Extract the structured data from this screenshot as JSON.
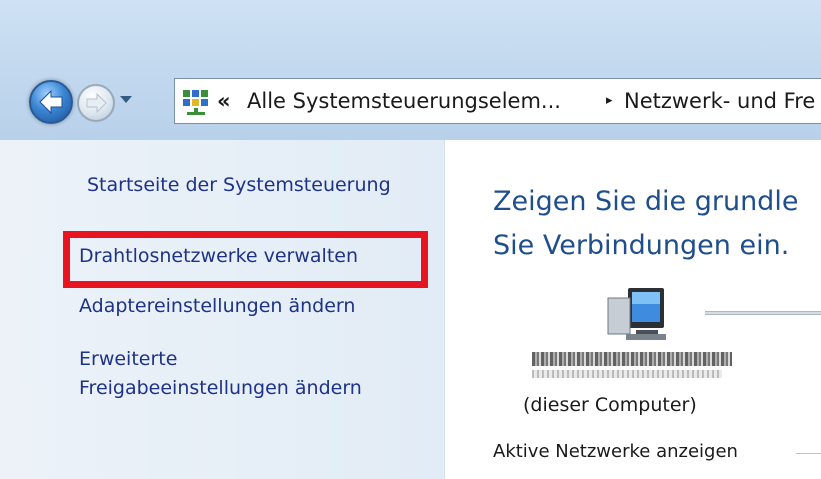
{
  "toolbar": {
    "back_icon": "back-arrow-icon",
    "forward_icon": "forward-arrow-icon",
    "history_icon": "chevron-down-icon"
  },
  "address_bar": {
    "icon": "control-panel-icon",
    "chevrons": "«",
    "crumbs": [
      "Alle Systemsteuerungselem...",
      "Netzwerk- und Fre"
    ],
    "separator": "▸"
  },
  "sidebar": {
    "items": [
      {
        "label": "Startseite der Systemsteuerung"
      },
      {
        "label": "Drahtlosnetzwerke verwalten",
        "highlighted": true
      },
      {
        "label": "Adaptereinstellungen ändern"
      },
      {
        "label": "Erweiterte\nFreigabeeinstellungen ändern"
      }
    ]
  },
  "main": {
    "title_line1": "Zeigen Sie die grundle",
    "title_line2": "Sie Verbindungen ein.",
    "computer_caption": "(dieser Computer)",
    "active_networks_heading": "Aktive Netzwerke anzeigen"
  },
  "colors": {
    "link": "#1e3287",
    "title": "#1e4e8c",
    "highlight": "#e8141f"
  }
}
